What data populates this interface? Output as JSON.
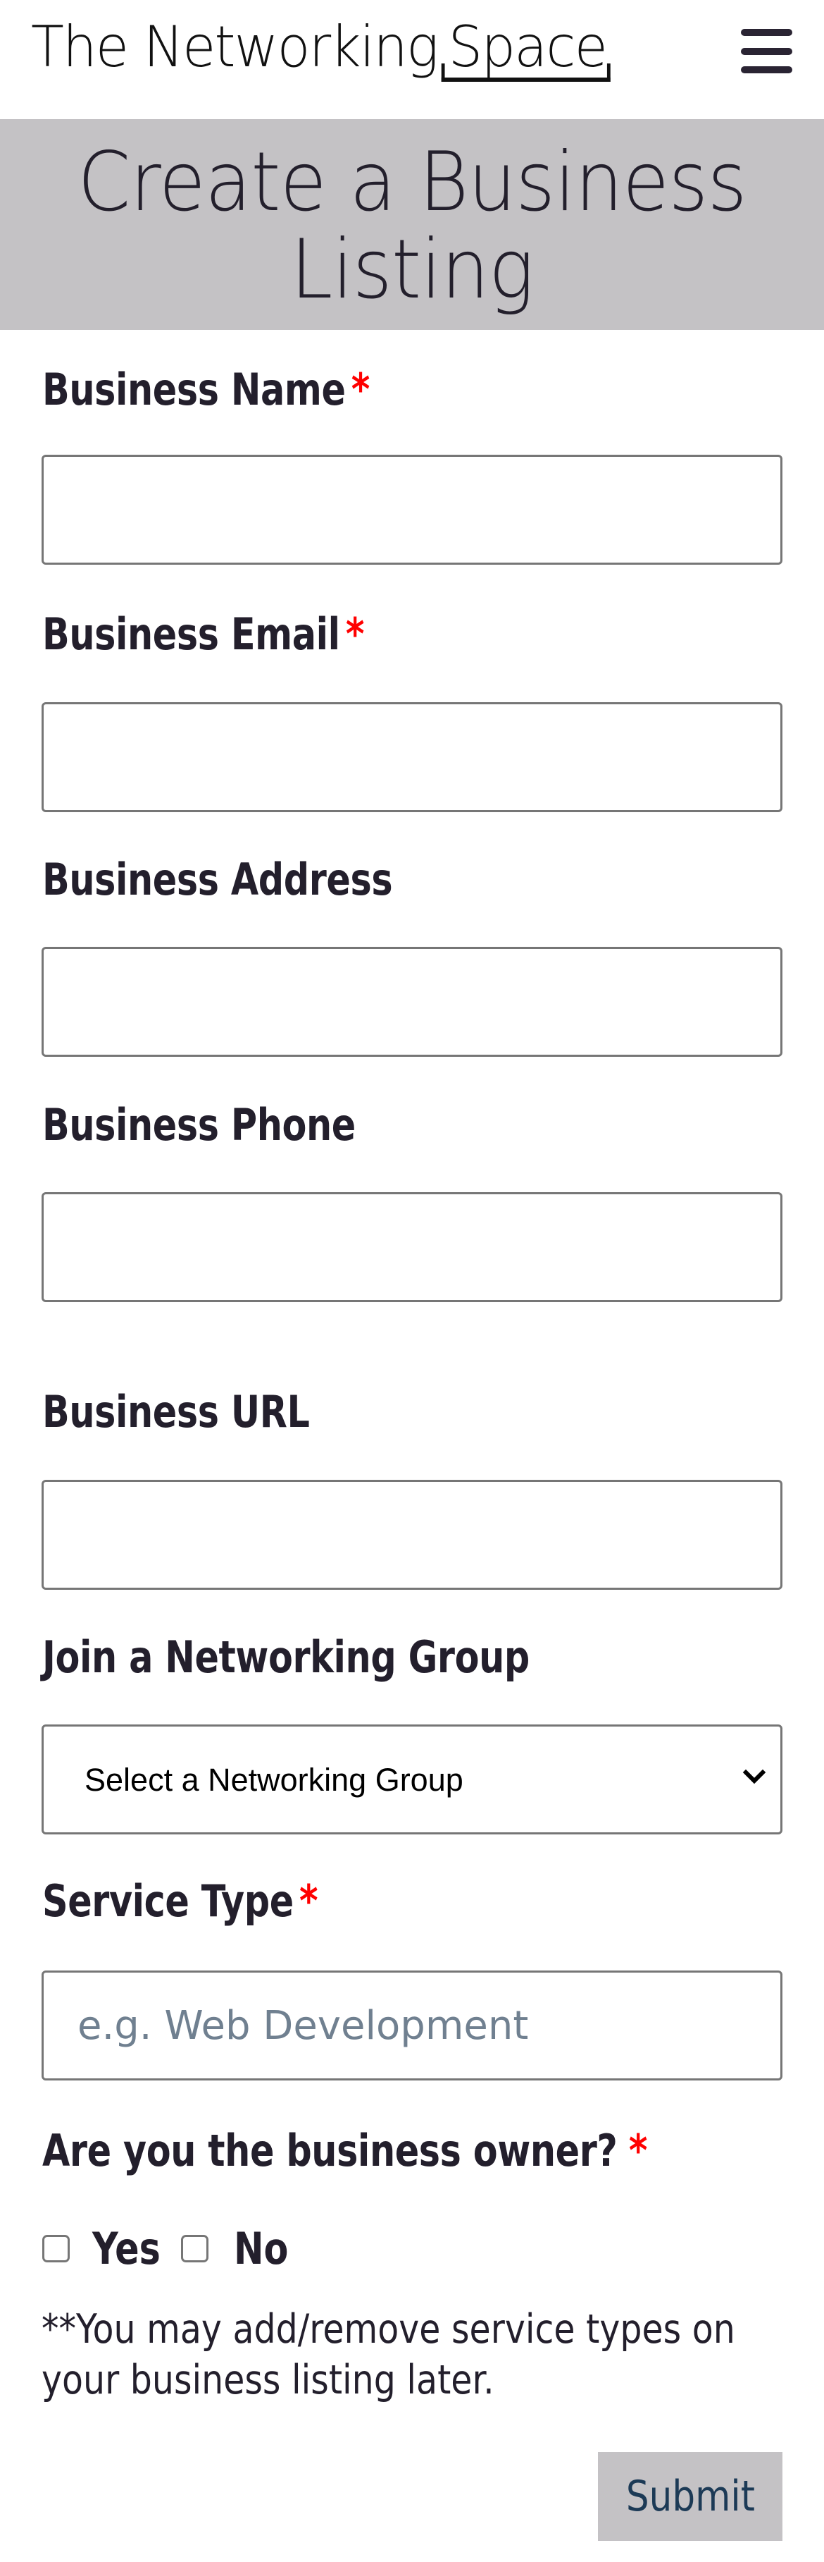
{
  "header": {
    "logo_prefix": "The Networking",
    "logo_highlight": "Space",
    "menu_icon": "hamburger-menu-icon"
  },
  "banner": {
    "title": "Create a Business Listing"
  },
  "colors": {
    "banner_bg": "#c4c2c5",
    "text": "#231f2c",
    "required": "#ff0000",
    "placeholder": "#708090",
    "submit_text": "#1c3a56"
  },
  "form": {
    "required_marker": "*",
    "fields": [
      {
        "label": "Business Name",
        "required": true,
        "value": "",
        "placeholder": ""
      },
      {
        "label": "Business Email",
        "required": true,
        "value": "",
        "placeholder": ""
      },
      {
        "label": "Business Address",
        "required": false,
        "value": "",
        "placeholder": ""
      },
      {
        "label": "Business Phone",
        "required": false,
        "value": "",
        "placeholder": ""
      },
      {
        "label": "Business URL",
        "required": false,
        "value": "",
        "placeholder": ""
      }
    ],
    "group": {
      "label": "Join a Networking Group",
      "selected": "Select a Networking Group"
    },
    "service_type": {
      "label": "Service Type",
      "required": true,
      "value": "",
      "placeholder": "e.g. Web Development"
    },
    "owner": {
      "label": "Are you the business owner?",
      "required": true,
      "options": [
        {
          "label": "Yes",
          "checked": false
        },
        {
          "label": "No",
          "checked": false
        }
      ]
    },
    "note": "**You may add/remove service types on your business listing later.",
    "submit_label": "Submit"
  }
}
